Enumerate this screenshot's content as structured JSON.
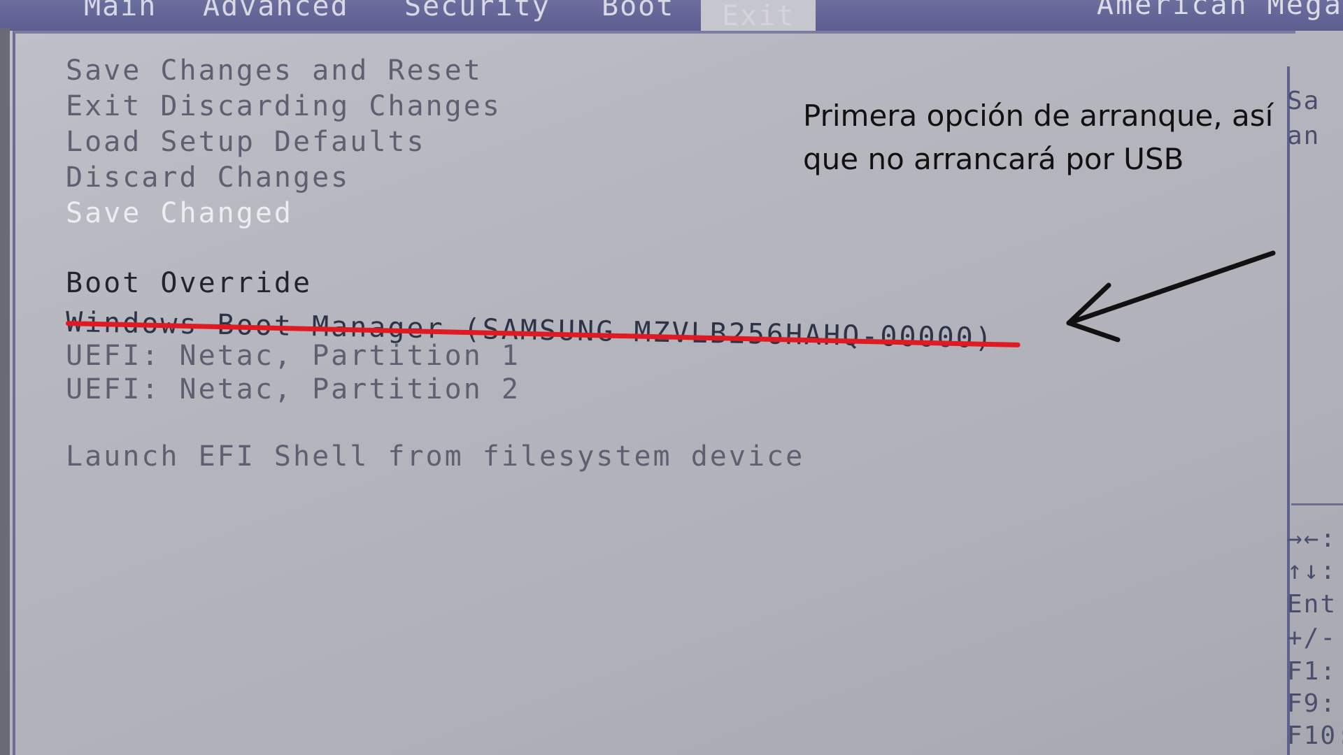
{
  "menubar": {
    "tabs": [
      {
        "label": "Main"
      },
      {
        "label": "Advanced"
      },
      {
        "label": "Security"
      },
      {
        "label": "Boot"
      },
      {
        "label": "Exit",
        "active": true
      }
    ],
    "brand": "American Mega"
  },
  "exit_menu": {
    "items": [
      {
        "label": "Save Changes and Reset"
      },
      {
        "label": "Exit Discarding Changes"
      },
      {
        "label": "Load Setup Defaults"
      },
      {
        "label": "Discard Changes"
      },
      {
        "label": "Save Changed",
        "selected": true
      }
    ],
    "boot_override": {
      "heading": "Boot Override",
      "options": [
        {
          "label": "Windows Boot Manager (SAMSUNG MZVLB256HAHQ-00000)"
        },
        {
          "label": "UEFI: Netac, Partition 1"
        },
        {
          "label": "UEFI: Netac, Partition 2"
        }
      ]
    },
    "efi_shell": "Launch EFI Shell from filesystem device"
  },
  "help_panel": {
    "description": [
      "Sa",
      "an"
    ],
    "keys": [
      "→←:",
      "↑↓:",
      "Ent",
      "+/-",
      "F1:",
      "F9:",
      "F10:"
    ]
  },
  "annotation": {
    "text": "Primera opción de arranque, así que no arrancará por USB",
    "underline_color": "#e01a22",
    "arrow_color": "#111111"
  }
}
